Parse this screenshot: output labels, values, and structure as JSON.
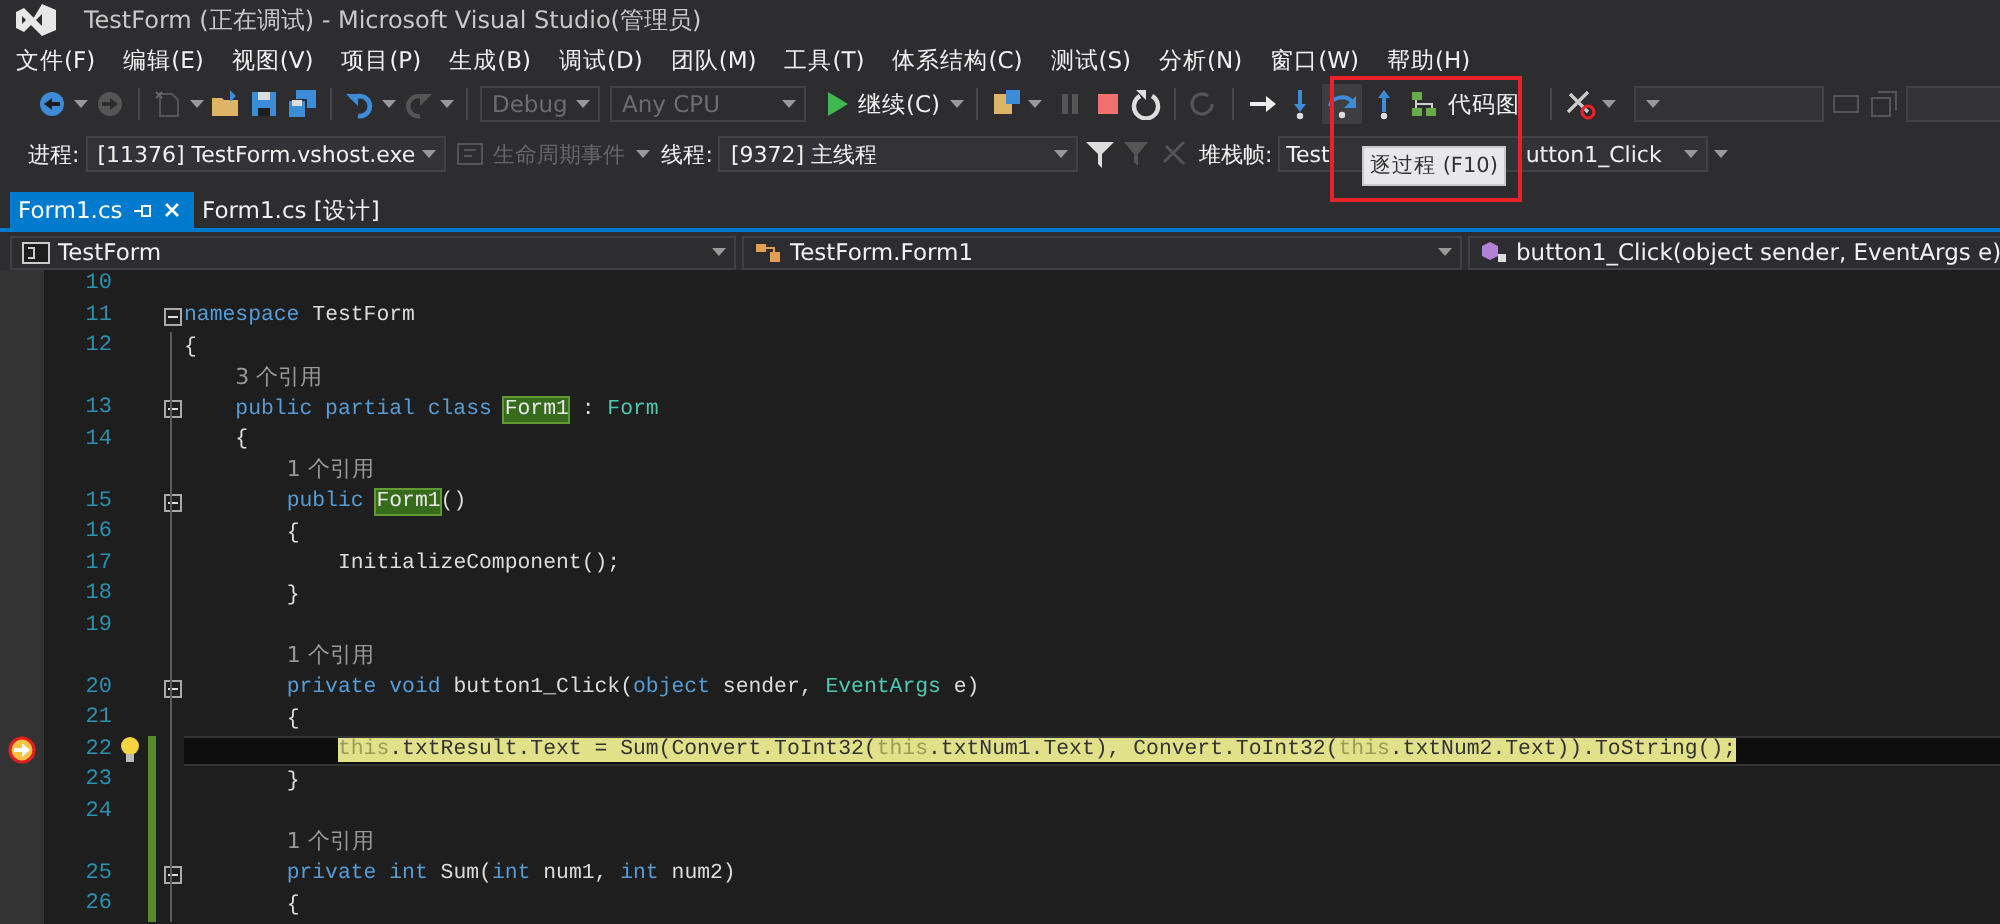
{
  "window": {
    "title": "TestForm (正在调试) - Microsoft Visual Studio(管理员)"
  },
  "menu": [
    "文件(F)",
    "编辑(E)",
    "视图(V)",
    "项目(P)",
    "生成(B)",
    "调试(D)",
    "团队(M)",
    "工具(T)",
    "体系结构(C)",
    "测试(S)",
    "分析(N)",
    "窗口(W)",
    "帮助(H)"
  ],
  "toolbar": {
    "configuration": {
      "value": "Debug",
      "disabled": true
    },
    "platform": {
      "value": "Any CPU",
      "disabled": true
    },
    "continue_button": "继续(C)",
    "code_map_button": "代码图",
    "step_over_hovered": true
  },
  "debug_location": {
    "process_label": "进程:",
    "process": "[11376] TestForm.vshost.exe",
    "lifecycle_button": {
      "label": "生命周期事件",
      "disabled": true
    },
    "thread_label": "线程:",
    "thread": "[9372] 主线程",
    "stack_frame_label": "堆栈帧:",
    "stack_frame_parts": [
      "Test",
      "utton1_Click"
    ]
  },
  "tooltip": "逐过程 (F10)",
  "tabs": [
    {
      "label": "Form1.cs",
      "selected": true
    },
    {
      "label": "Form1.cs [设计]",
      "selected": false
    }
  ],
  "nav_bar": [
    "TestForm",
    "TestForm.Form1",
    "button1_Click(object sender, EventArgs e)"
  ],
  "editor": {
    "lines": [
      {
        "kind": "code",
        "number": "10",
        "current": false,
        "lightbulb": false,
        "changed": false
      },
      {
        "kind": "code",
        "number": "11",
        "expanded": true,
        "current": false,
        "lightbulb": false,
        "changed": false,
        "tokens": [
          {
            "kind": "keyword",
            "text": "namespace"
          },
          {
            "kind": "plain",
            "text": " TestForm"
          }
        ]
      },
      {
        "kind": "code",
        "number": "12",
        "current": false,
        "lightbulb": false,
        "changed": false,
        "tokens": [
          {
            "kind": "plain",
            "text": "{"
          }
        ]
      },
      {
        "kind": "lens",
        "current": false,
        "lightbulb": false,
        "changed": false,
        "tokens": [
          {
            "kind": "lens",
            "text": "    3 个引用"
          }
        ]
      },
      {
        "kind": "code",
        "number": "13",
        "expanded": true,
        "current": false,
        "lightbulb": false,
        "changed": false,
        "tokens": [
          {
            "kind": "keyword",
            "text": "    public partial class "
          },
          {
            "kind": "match",
            "text": "Form1"
          },
          {
            "kind": "plain",
            "text": " : "
          },
          {
            "kind": "type",
            "text": "Form"
          }
        ]
      },
      {
        "kind": "code",
        "number": "14",
        "current": false,
        "lightbulb": false,
        "changed": false,
        "tokens": [
          {
            "kind": "plain",
            "text": "    {"
          }
        ]
      },
      {
        "kind": "lens",
        "current": false,
        "lightbulb": false,
        "changed": false,
        "tokens": [
          {
            "kind": "lens",
            "text": "        1 个引用"
          }
        ]
      },
      {
        "kind": "code",
        "number": "15",
        "expanded": true,
        "current": false,
        "lightbulb": false,
        "changed": false,
        "tokens": [
          {
            "kind": "keyword",
            "text": "        public "
          },
          {
            "kind": "match",
            "text": "Form1"
          },
          {
            "kind": "plain",
            "text": "()"
          }
        ]
      },
      {
        "kind": "code",
        "number": "16",
        "current": false,
        "lightbulb": false,
        "changed": false,
        "tokens": [
          {
            "kind": "plain",
            "text": "        {"
          }
        ]
      },
      {
        "kind": "code",
        "number": "17",
        "current": false,
        "lightbulb": false,
        "changed": false,
        "tokens": [
          {
            "kind": "plain",
            "text": "            InitializeComponent();"
          }
        ]
      },
      {
        "kind": "code",
        "number": "18",
        "current": false,
        "lightbulb": false,
        "changed": false,
        "tokens": [
          {
            "kind": "plain",
            "text": "        }"
          }
        ]
      },
      {
        "kind": "code",
        "number": "19",
        "current": false,
        "lightbulb": false,
        "changed": false
      },
      {
        "kind": "lens",
        "current": false,
        "lightbulb": false,
        "changed": false,
        "tokens": [
          {
            "kind": "lens",
            "text": "        1 个引用"
          }
        ]
      },
      {
        "kind": "code",
        "number": "20",
        "expanded": true,
        "current": false,
        "lightbulb": false,
        "changed": false,
        "tokens": [
          {
            "kind": "keyword",
            "text": "        private void"
          },
          {
            "kind": "plain",
            "text": " button1_Click("
          },
          {
            "kind": "keyword",
            "text": "object"
          },
          {
            "kind": "plain",
            "text": " sender, "
          },
          {
            "kind": "type",
            "text": "EventArgs"
          },
          {
            "kind": "plain",
            "text": " e)"
          }
        ]
      },
      {
        "kind": "code",
        "number": "21",
        "current": false,
        "lightbulb": false,
        "changed": false,
        "tokens": [
          {
            "kind": "plain",
            "text": "        {"
          }
        ]
      },
      {
        "kind": "code",
        "number": "22",
        "current": true,
        "lightbulb": true,
        "changed": true,
        "tokens": [
          {
            "kind": "dim",
            "text": "            this"
          },
          {
            "kind": "plain",
            "text": ".txtResult.Text = Sum(Convert.ToInt32("
          },
          {
            "kind": "dim",
            "text": "this"
          },
          {
            "kind": "plain",
            "text": ".txtNum1.Text), Convert.ToInt32("
          },
          {
            "kind": "dim",
            "text": "this"
          },
          {
            "kind": "plain",
            "text": ".txtNum2.Text)).ToString();"
          }
        ]
      },
      {
        "kind": "code",
        "number": "23",
        "current": false,
        "lightbulb": false,
        "changed": true,
        "tokens": [
          {
            "kind": "plain",
            "text": "        }"
          }
        ]
      },
      {
        "kind": "code",
        "number": "24",
        "current": false,
        "lightbulb": false,
        "changed": true
      },
      {
        "kind": "lens",
        "current": false,
        "lightbulb": false,
        "changed": true,
        "tokens": [
          {
            "kind": "lens",
            "text": "        1 个引用"
          }
        ]
      },
      {
        "kind": "code",
        "number": "25",
        "expanded": true,
        "current": false,
        "lightbulb": false,
        "changed": true,
        "tokens": [
          {
            "kind": "keyword",
            "text": "        private int"
          },
          {
            "kind": "plain",
            "text": " Sum("
          },
          {
            "kind": "keyword",
            "text": "int"
          },
          {
            "kind": "plain",
            "text": " num1, "
          },
          {
            "kind": "keyword",
            "text": "int"
          },
          {
            "kind": "plain",
            "text": " num2)"
          }
        ]
      },
      {
        "kind": "code",
        "number": "26",
        "current": false,
        "lightbulb": false,
        "changed": true,
        "tokens": [
          {
            "kind": "plain",
            "text": "        {"
          }
        ]
      }
    ]
  }
}
